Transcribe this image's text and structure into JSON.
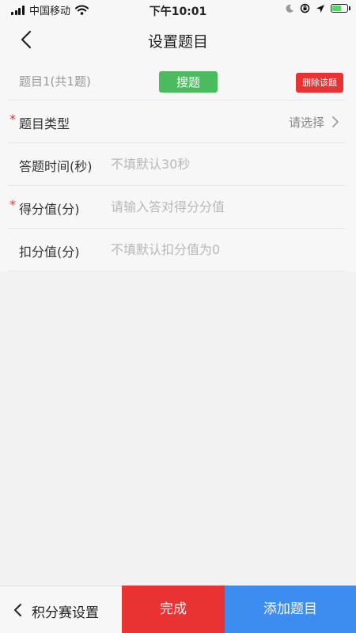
{
  "status_bar": {
    "carrier": "中国移动",
    "time": "下午10:01",
    "battery_color": "#4cd964"
  },
  "nav": {
    "title": "设置题目",
    "back_icon": "chevron-left-icon"
  },
  "question_header": {
    "index_label": "题目1(共1题)",
    "search_label": "搜题",
    "delete_label": "删除该题",
    "search_color": "#4cba5e",
    "delete_color": "#e93232"
  },
  "fields": {
    "type": {
      "required_mark": "*",
      "label": "题目类型",
      "value": "请选择"
    },
    "time": {
      "label": "答题时间(秒)",
      "placeholder": "不填默认30秒"
    },
    "score": {
      "required_mark": "*",
      "label": "得分值(分)",
      "placeholder": "请输入答对得分分值"
    },
    "deduct": {
      "label": "扣分值(分)",
      "placeholder": "不填默认扣分值为0"
    }
  },
  "bottom_bar": {
    "back_label": "积分赛设置",
    "done_label": "完成",
    "add_label": "添加题目",
    "done_color": "#e93232",
    "add_color": "#3d8cf0"
  }
}
